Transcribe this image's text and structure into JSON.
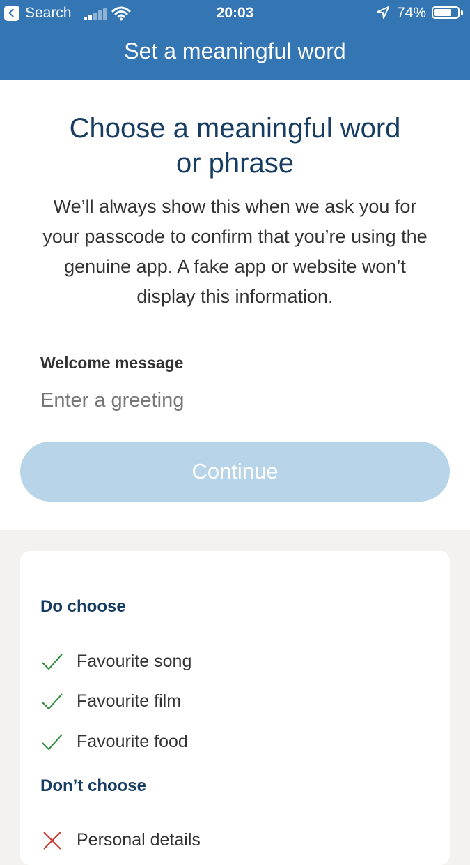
{
  "status_bar": {
    "back_label": "Search",
    "time": "20:03",
    "battery": "74%",
    "battery_level": 0.74
  },
  "nav": {
    "title": "Set a meaningful word"
  },
  "main": {
    "heading": "Choose a meaningful word or phrase",
    "description": "We’ll always show this when we ask you for your passcode to confirm that you’re using the genuine app. A fake app or website won’t display this information.",
    "field_label": "Welcome message",
    "field_placeholder": "Enter a greeting",
    "field_value": "",
    "continue_label": "Continue"
  },
  "tips": {
    "do_title": "Do choose",
    "do_items": [
      {
        "label": "Favourite song",
        "icon": "check-icon"
      },
      {
        "label": "Favourite film",
        "icon": "check-icon"
      },
      {
        "label": "Favourite food",
        "icon": "check-icon"
      }
    ],
    "dont_title": "Don’t choose",
    "dont_items": [
      {
        "label": "Personal details",
        "icon": "cross-icon"
      }
    ]
  },
  "colors": {
    "header": "#3475b3",
    "heading": "#173d63",
    "button_disabled": "#b8d4e8",
    "check": "#2e8b3a",
    "cross": "#d0332e"
  }
}
